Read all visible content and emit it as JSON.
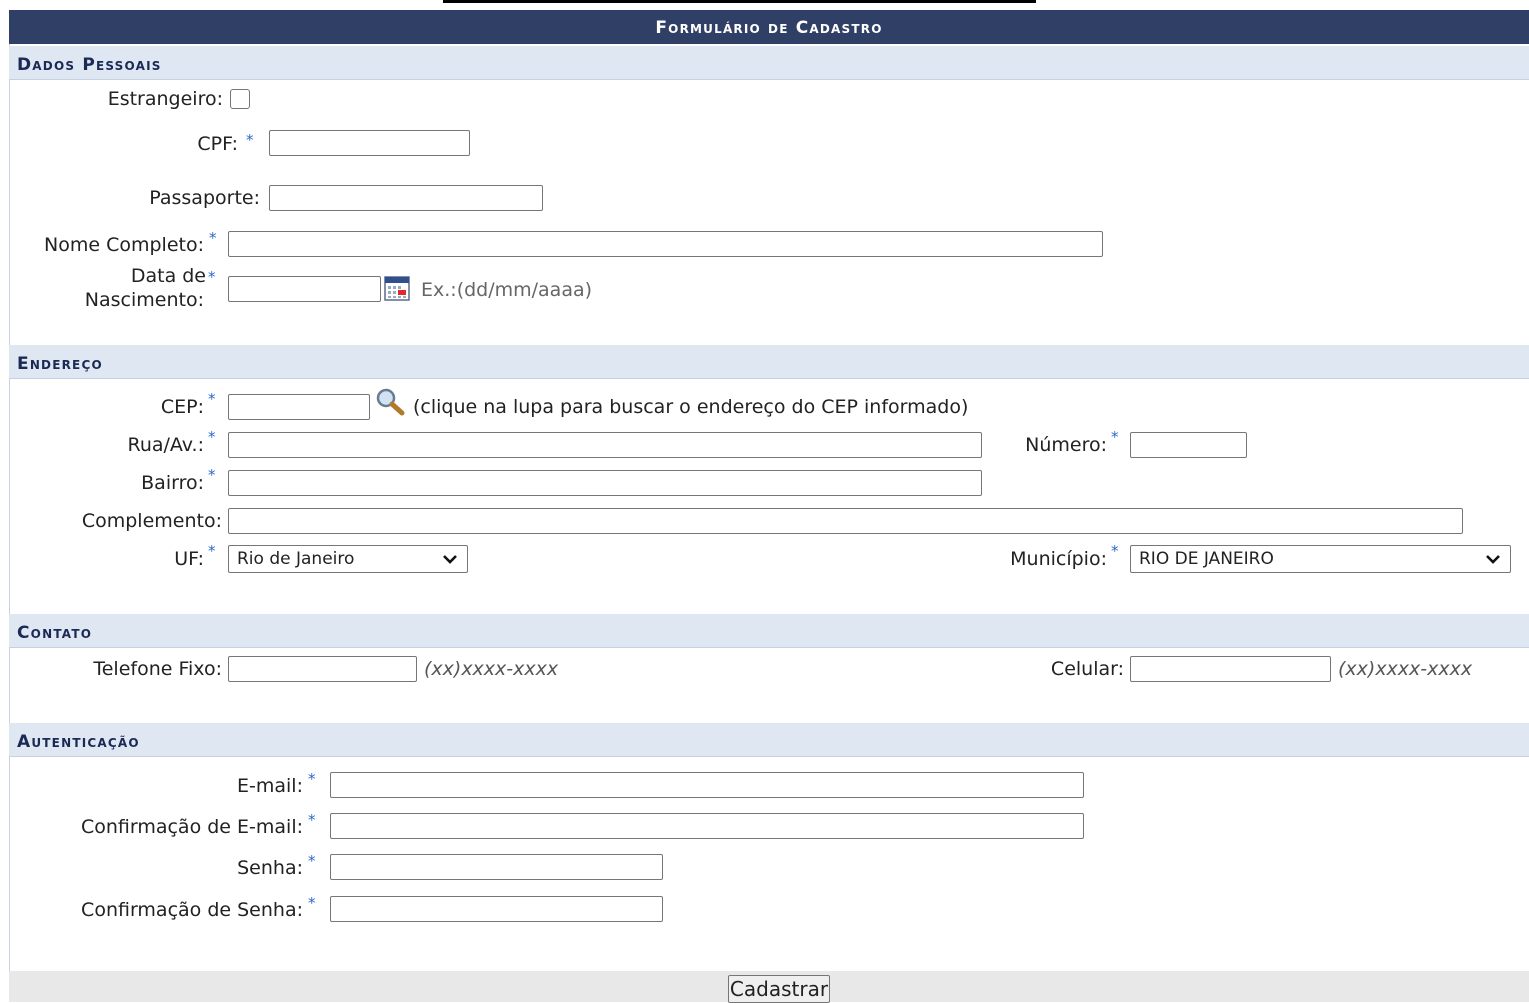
{
  "form": {
    "title": "Formulário de Cadastro",
    "submit_label": "Cadastrar"
  },
  "dados_pessoais": {
    "heading": "Dados Pessoais",
    "estrangeiro_label": "Estrangeiro:",
    "cpf_label": "CPF:",
    "passaporte_label": "Passaporte:",
    "nome_label": "Nome Completo:",
    "nascimento_label_1": "Data de",
    "nascimento_label_2": "Nascimento:",
    "nascimento_hint": "Ex.:(dd/mm/aaaa)"
  },
  "endereco": {
    "heading": "Endereço",
    "cep_label": "CEP:",
    "cep_hint": "(clique na lupa para buscar o endereço do CEP informado)",
    "rua_label": "Rua/Av.:",
    "numero_label": "Número:",
    "bairro_label": "Bairro:",
    "complemento_label": "Complemento:",
    "uf_label": "UF:",
    "uf_value": "Rio de Janeiro",
    "municipio_label": "Município:",
    "municipio_value": "RIO DE JANEIRO"
  },
  "contato": {
    "heading": "Contato",
    "telefone_label": "Telefone Fixo:",
    "telefone_hint": "(xx)xxxx-xxxx",
    "celular_label": "Celular:",
    "celular_hint": "(xx)xxxx-xxxx"
  },
  "autenticacao": {
    "heading": "Autenticação",
    "email_label": "E-mail:",
    "email_confirm_label": "Confirmação de E-mail:",
    "senha_label": "Senha:",
    "senha_confirm_label": "Confirmação de Senha:"
  },
  "required_marker": "*",
  "colors": {
    "title_bar": "#303f65",
    "section_bg": "#dfe7f3",
    "required_star": "#2c68c9"
  }
}
